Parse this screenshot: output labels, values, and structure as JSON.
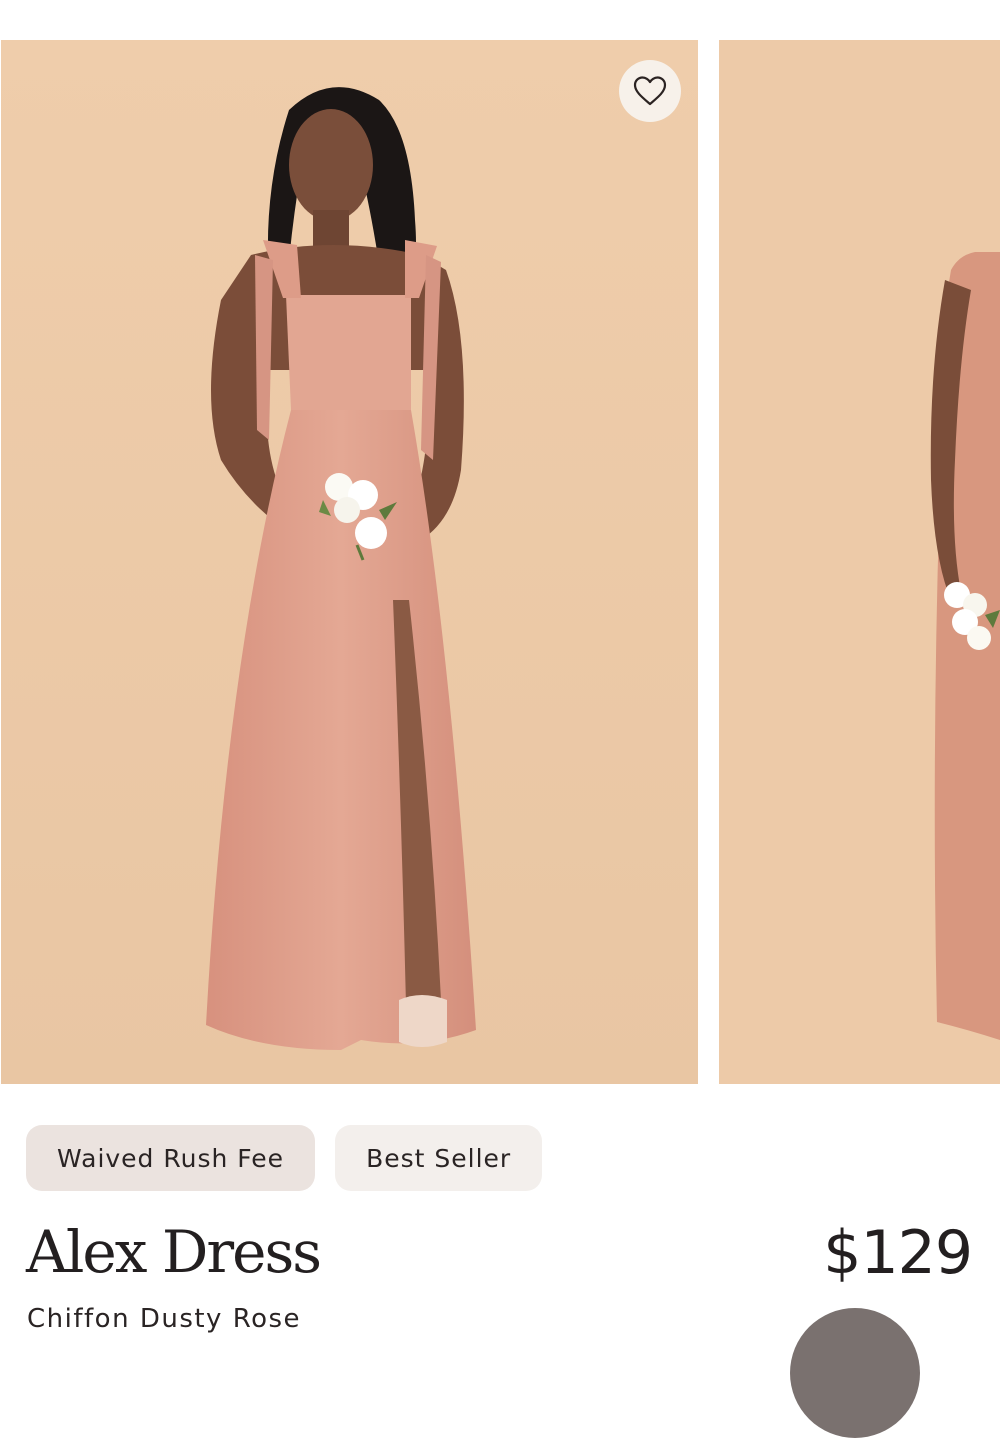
{
  "product": {
    "name": "Alex Dress",
    "subtitle": "Chiffon Dusty Rose",
    "price": "$129",
    "badges": [
      {
        "label": "Waived Rush Fee"
      },
      {
        "label": "Best Seller"
      }
    ]
  },
  "favorite": {
    "icon": "heart-icon"
  },
  "colors": {
    "backdrop": "#ecc9a6",
    "dress": "#dd9f8c",
    "text": "#231f20",
    "badge_rush_bg": "#ebe3df",
    "badge_best_bg": "#f3efec",
    "swatch": "#7a716f"
  }
}
